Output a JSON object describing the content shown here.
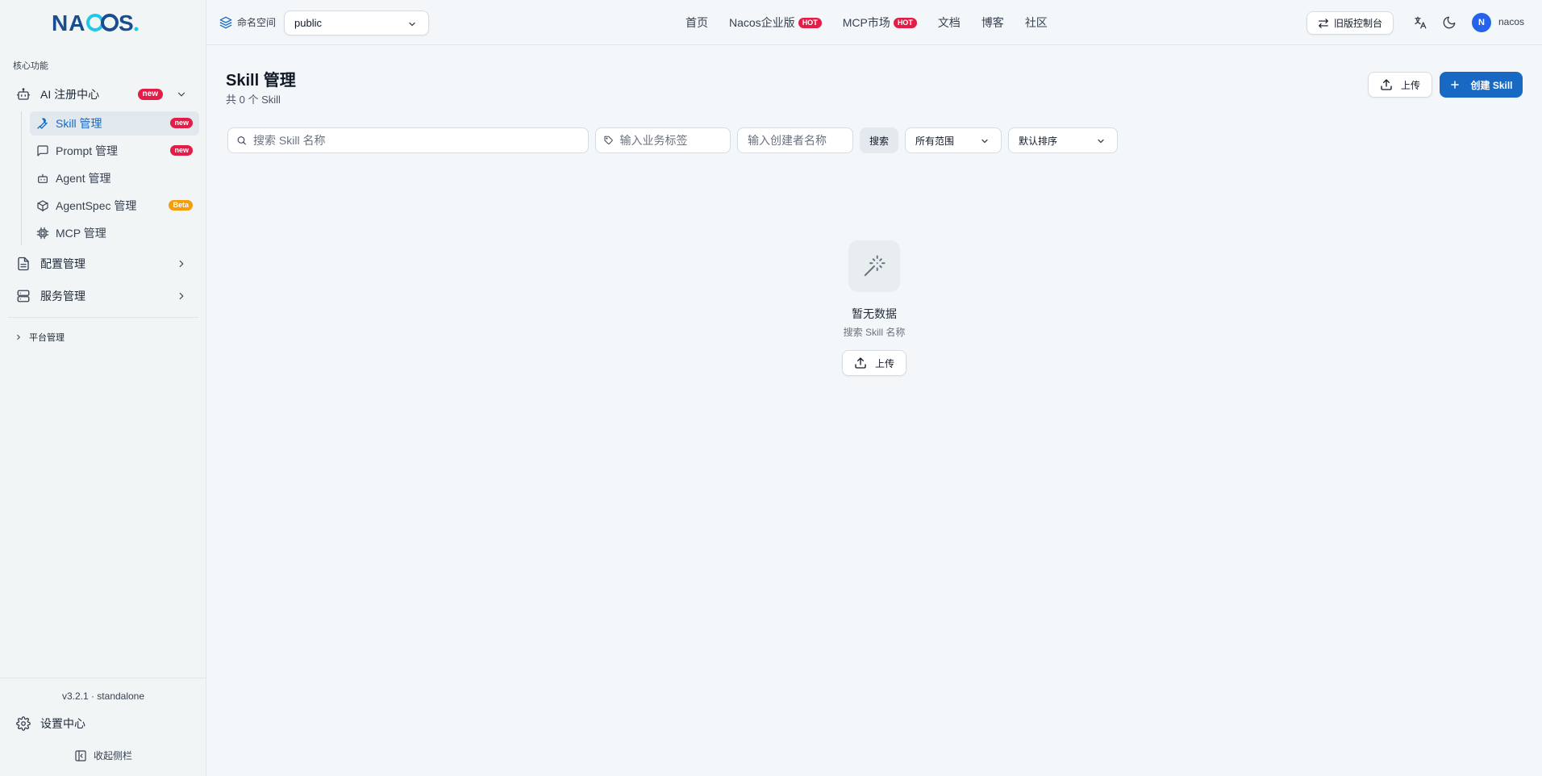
{
  "brand": {
    "logo_text": "NACOS.",
    "logo_color": "#1a4d8f",
    "accent_color": "#1ec8e6"
  },
  "sidebar": {
    "section_title": "核心功能",
    "ai_registry": {
      "label": "AI 注册中心",
      "badge": "new",
      "icon": "robot-icon"
    },
    "sub_items": [
      {
        "label": "Skill 管理",
        "badge": "new",
        "icon": "wrench-icon",
        "active": true
      },
      {
        "label": "Prompt 管理",
        "badge": "new",
        "icon": "message-square-icon"
      },
      {
        "label": "Agent 管理",
        "badge": "",
        "icon": "bot-icon"
      },
      {
        "label": "AgentSpec 管理",
        "badge": "Beta",
        "icon": "package-icon"
      },
      {
        "label": "MCP 管理",
        "badge": "",
        "icon": "chip-icon"
      }
    ],
    "config_mgmt": {
      "label": "配置管理",
      "icon": "file-text-icon"
    },
    "service_mgmt": {
      "label": "服务管理",
      "icon": "server-icon"
    },
    "platform_mgmt": {
      "label": "平台管理"
    },
    "version": "v3.2.1 · standalone",
    "settings": {
      "label": "设置中心",
      "icon": "gear-icon"
    },
    "collapse": {
      "label": "收起侧栏",
      "icon": "panel-left-icon"
    }
  },
  "topbar": {
    "namespace_label": "命名空间",
    "namespace_value": "public",
    "nav": [
      {
        "label": "首页",
        "badge": ""
      },
      {
        "label": "Nacos企业版",
        "badge": "HOT"
      },
      {
        "label": "MCP市场",
        "badge": "HOT"
      },
      {
        "label": "文档",
        "badge": ""
      },
      {
        "label": "博客",
        "badge": ""
      },
      {
        "label": "社区",
        "badge": ""
      }
    ],
    "old_console": "旧版控制台",
    "user_initial": "N",
    "username": "nacos"
  },
  "main": {
    "title": "Skill 管理",
    "subtitle": "共 0 个 Skill",
    "upload_label": "上传",
    "create_label": "创建 Skill",
    "filters": {
      "search_placeholder": "搜索 Skill 名称",
      "tag_placeholder": "输入业务标签",
      "creator_placeholder": "输入创建者名称",
      "search_button": "搜索",
      "scope_value": "所有范围",
      "sort_value": "默认排序"
    },
    "empty": {
      "title": "暂无数据",
      "subtitle": "搜索 Skill 名称",
      "upload_label": "上传",
      "icon": "magic-wand-icon"
    }
  }
}
